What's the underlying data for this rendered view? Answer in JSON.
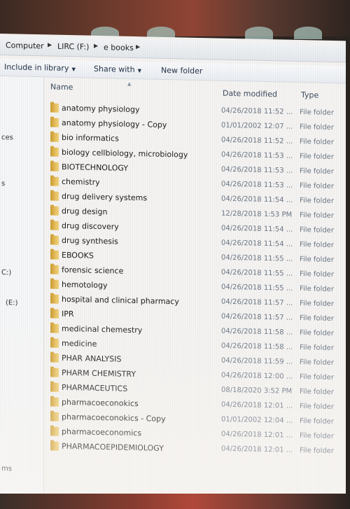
{
  "breadcrumb": {
    "items": [
      "Computer",
      "LIRC (F:)",
      "e books"
    ]
  },
  "toolbar": {
    "include_label": "Include in library",
    "share_label": "Share with",
    "new_folder_label": "New folder"
  },
  "sidebar": {
    "items": [
      "ces",
      "s",
      "C:)",
      "(E:)",
      "ms"
    ]
  },
  "columns": {
    "name": "Name",
    "date": "Date modified",
    "type": "Type"
  },
  "files": [
    {
      "name": "anatomy physiology",
      "date": "04/26/2018 11:52 ...",
      "type": "File folder"
    },
    {
      "name": "anatomy physiology - Copy",
      "date": "01/01/2002 12:07 ...",
      "type": "File folder"
    },
    {
      "name": "bio informatics",
      "date": "04/26/2018 11:52 ...",
      "type": "File folder"
    },
    {
      "name": "biology cellbiology, microbiology",
      "date": "04/26/2018 11:53 ...",
      "type": "File folder"
    },
    {
      "name": "BIOTECHNOLOGY",
      "date": "04/26/2018 11:53 ...",
      "type": "File folder"
    },
    {
      "name": "chemistry",
      "date": "04/26/2018 11:53 ...",
      "type": "File folder"
    },
    {
      "name": "drug delivery systems",
      "date": "04/26/2018 11:54 ...",
      "type": "File folder"
    },
    {
      "name": "drug design",
      "date": "12/28/2018 1:53 PM",
      "type": "File folder"
    },
    {
      "name": "drug discovery",
      "date": "04/26/2018 11:54 ...",
      "type": "File folder"
    },
    {
      "name": "drug synthesis",
      "date": "04/26/2018 11:54 ...",
      "type": "File folder"
    },
    {
      "name": "EBOOKS",
      "date": "04/26/2018 11:55 ...",
      "type": "File folder"
    },
    {
      "name": "forensic science",
      "date": "04/26/2018 11:55 ...",
      "type": "File folder"
    },
    {
      "name": "hemotology",
      "date": "04/26/2018 11:55 ...",
      "type": "File folder"
    },
    {
      "name": "hospital and clinical pharmacy",
      "date": "04/26/2018 11:57 ...",
      "type": "File folder"
    },
    {
      "name": "IPR",
      "date": "04/26/2018 11:57 ...",
      "type": "File folder"
    },
    {
      "name": "medicinal chemestry",
      "date": "04/26/2018 11:58 ...",
      "type": "File folder"
    },
    {
      "name": "medicine",
      "date": "04/26/2018 11:58 ...",
      "type": "File folder"
    },
    {
      "name": "PHAR ANALYSIS",
      "date": "04/26/2018 11:59 ...",
      "type": "File folder"
    },
    {
      "name": "PHARM CHEMISTRY",
      "date": "04/26/2018 12:00 ...",
      "type": "File folder"
    },
    {
      "name": "PHARMACEUTICS",
      "date": "08/18/2020 3:52 PM",
      "type": "File folder"
    },
    {
      "name": "pharmacoeconokics",
      "date": "04/26/2018 12:01 ...",
      "type": "File folder"
    },
    {
      "name": "pharmacoeconokics - Copy",
      "date": "01/01/2002 12:04 ...",
      "type": "File folder"
    },
    {
      "name": "pharmacoeconomics",
      "date": "04/26/2018 12:01 ...",
      "type": "File folder"
    },
    {
      "name": "PHARMACOEPIDEMIOLOGY",
      "date": "04/26/2018 12:01 ...",
      "type": "File folder"
    }
  ]
}
